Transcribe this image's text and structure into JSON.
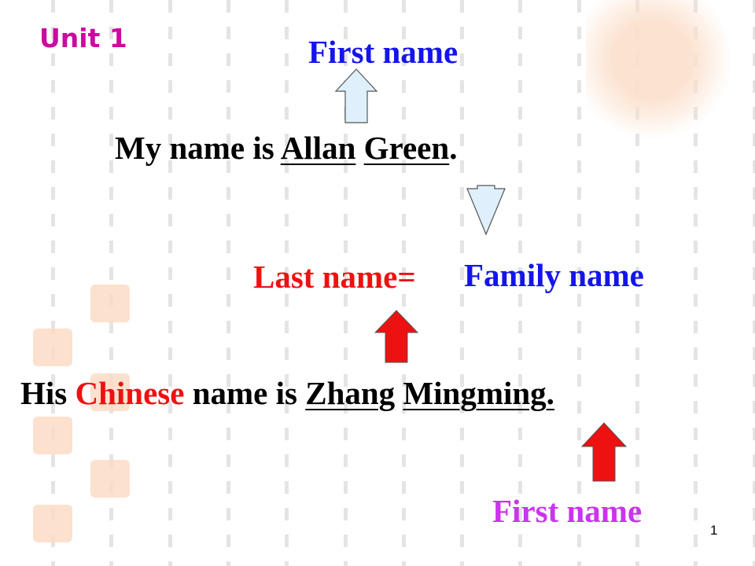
{
  "slide": {
    "unit_label": "Unit 1",
    "top_label": "First name",
    "sentence1": {
      "prefix": "My name is ",
      "first": "Allan",
      "last": "Green",
      "end": "."
    },
    "middle_label": {
      "last_name": "Last name=",
      "family_name": "Family name"
    },
    "sentence2": {
      "his": "His ",
      "chinese": "Chinese",
      "rest": " name is ",
      "family": "Zhang",
      "given": "Mingming."
    },
    "bottom_label": "First name",
    "page_number": "1"
  },
  "colors": {
    "unit": "#cc0aa0",
    "blue": "#1414ee",
    "red": "#ee1111",
    "purple": "#cc33ee",
    "arrow_light": "#dff0fc",
    "arrow_red": "#ee1111",
    "seal": "#fbd9c2"
  }
}
